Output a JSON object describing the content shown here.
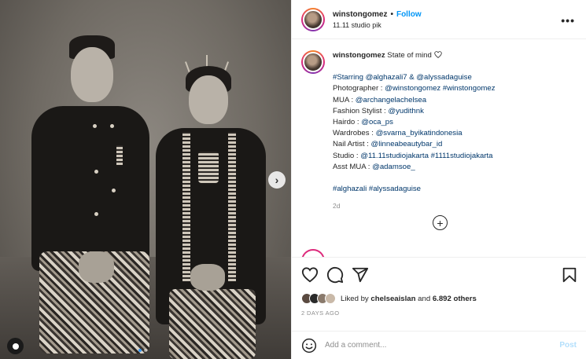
{
  "header": {
    "username": "winstongomez",
    "separator": "•",
    "follow_label": "Follow",
    "location": "11.11 studio pik",
    "more_icon": "more-horizontal-icon"
  },
  "caption": {
    "username": "winstongomez",
    "first_line": "State of mind",
    "lines": [
      {
        "prefix": "",
        "text": "#Starring @alghazali7 & @alyssadaguise"
      },
      {
        "prefix": "Photographer : ",
        "text": "@winstongomez #winstongomez"
      },
      {
        "prefix": "MUA : ",
        "text": "@archangelachelsea"
      },
      {
        "prefix": "Fashion Stylist : ",
        "text": "@yudithnk"
      },
      {
        "prefix": "Hairdo : ",
        "text": "@oca_ps"
      },
      {
        "prefix": "Wardrobes : ",
        "text": "@svarna_byikatindonesia"
      },
      {
        "prefix": "Nail Artist : ",
        "text": "@linneabeautybar_id"
      },
      {
        "prefix": "Studio : ",
        "text": "@11.11studiojakarta #1111studiojakarta"
      },
      {
        "prefix": "Asst MUA : ",
        "text": "@adamsoe_"
      }
    ],
    "hashtags": "#alghazali #alyssadaguise",
    "time": "2d"
  },
  "likes": {
    "liked_by_prefix": "Liked by ",
    "liked_by_user": "chelseaislan",
    "and": " and ",
    "others": "6.892 others"
  },
  "posted_ago": "2 DAYS AGO",
  "comment": {
    "placeholder": "Add a comment...",
    "post_label": "Post"
  },
  "carousel": {
    "total": 2,
    "active_index": 0
  },
  "colors": {
    "link": "#00376b",
    "follow": "#0095f6",
    "post_disabled": "#b2dffc",
    "muted": "#8e8e8e"
  }
}
